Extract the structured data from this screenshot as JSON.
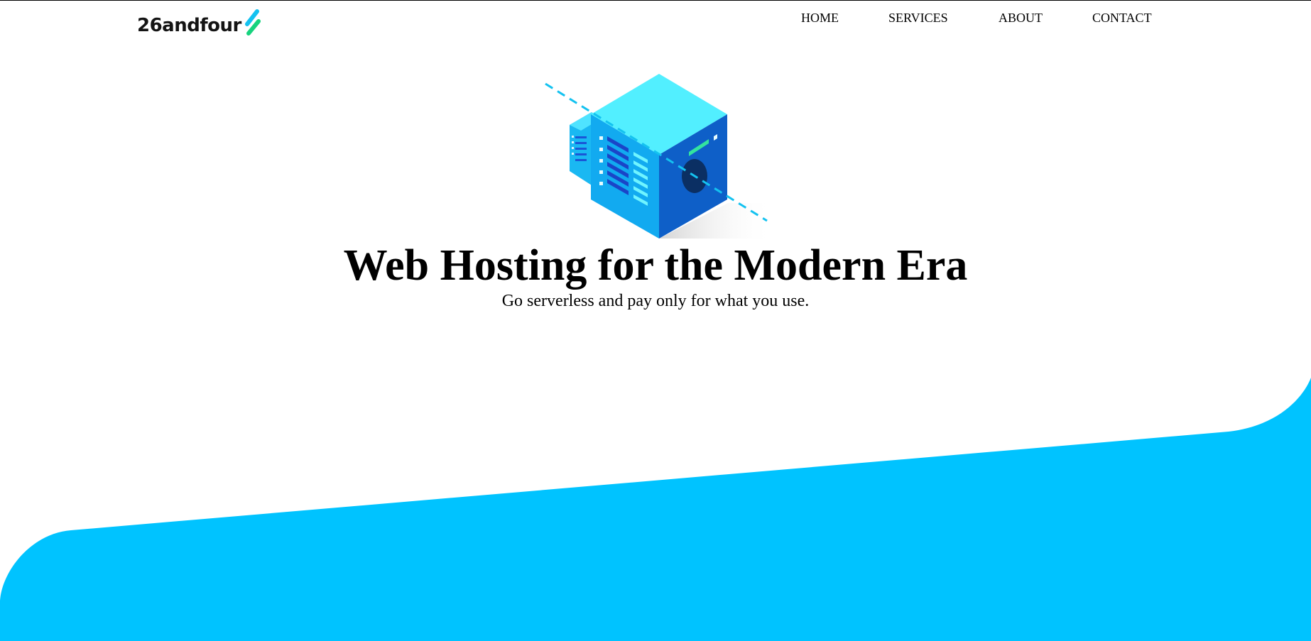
{
  "brand": {
    "name": "26andfour",
    "mark_colors": [
      "#14c2f0",
      "#17d37e"
    ]
  },
  "nav": {
    "items": [
      {
        "label": "HOME"
      },
      {
        "label": "SERVICES"
      },
      {
        "label": "ABOUT"
      },
      {
        "label": "CONTACT"
      }
    ]
  },
  "hero": {
    "illustration": "isometric-server-icon",
    "title": "Web Hosting for the Modern Era",
    "subtitle": "Go serverless and pay only for what you use."
  },
  "colors": {
    "accent": "#00c3ff",
    "text": "#000000",
    "background": "#ffffff"
  }
}
